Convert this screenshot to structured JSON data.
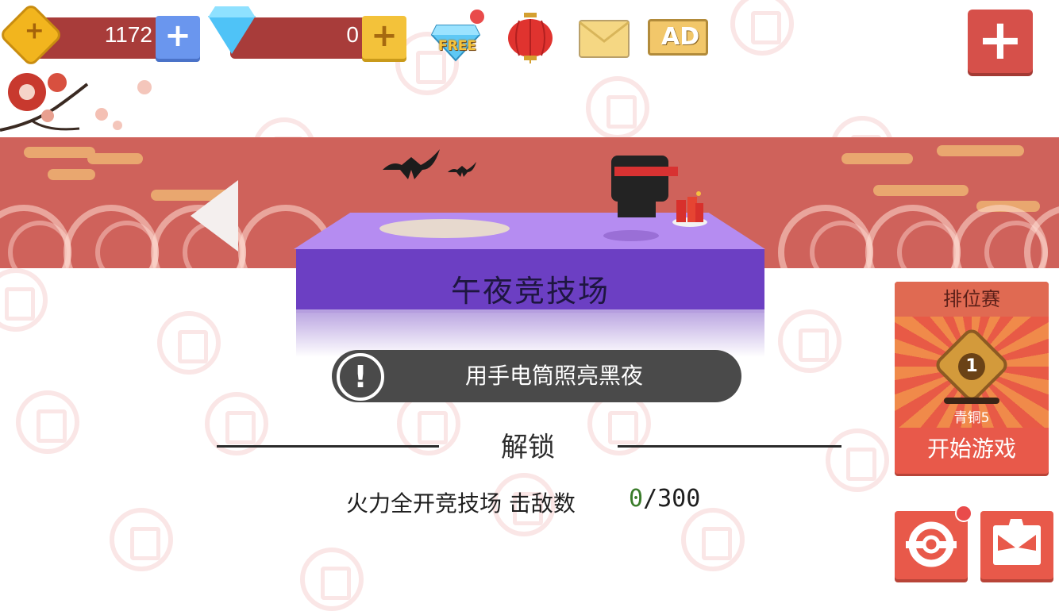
{
  "resources": {
    "coins": "1172",
    "gems": "0"
  },
  "top_icons": {
    "free_gem_label": "FREE",
    "ad_label": "AD"
  },
  "arena": {
    "title": "午夜竞技场",
    "hint": "用手电筒照亮黑夜"
  },
  "unlock": {
    "heading": "解锁",
    "requirement": "火力全开竞技场 击敌数",
    "current": "0",
    "target": "/300"
  },
  "ranked": {
    "title": "排位赛",
    "level": "1",
    "tier": "青铜5",
    "start_label": "开始游戏"
  },
  "colors": {
    "banner": "#cf625b",
    "platform_front": "#6c3fc3",
    "platform_top": "#b58cf1",
    "accent_red": "#e8594a",
    "coin_plus": "#6a96ee",
    "gem_plus": "#f3c23a"
  }
}
